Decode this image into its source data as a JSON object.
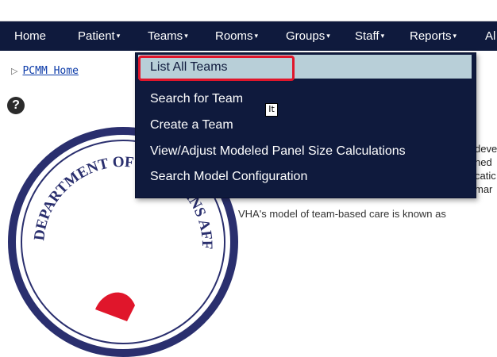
{
  "navbar": {
    "items": [
      {
        "label": "Home",
        "has_caret": false
      },
      {
        "label": "Patient",
        "has_caret": true
      },
      {
        "label": "Teams",
        "has_caret": true
      },
      {
        "label": "Rooms",
        "has_caret": true
      },
      {
        "label": "Groups",
        "has_caret": true
      },
      {
        "label": "Staff",
        "has_caret": true
      },
      {
        "label": "Reports",
        "has_caret": true
      },
      {
        "label": "Al",
        "has_caret": false
      }
    ],
    "caret_glyph": "▾",
    "background": "#0f1a3d"
  },
  "breadcrumb": {
    "label": "PCMM Home"
  },
  "teams_menu": {
    "items": [
      "List All Teams",
      "Search for Team",
      "Create a Team",
      "View/Adjust Modeled Panel Size Calculations",
      "Search Model Configuration"
    ],
    "highlighted_index": 0,
    "highlight_color": "#b8cfd8",
    "annotation_border_color": "#e0162b"
  },
  "seal": {
    "text": "DEPARTMENT OF VETERANS AFFAIRS"
  },
  "cursor_tooltip": "It",
  "body_text": {
    "line1": "deve",
    "line2": "ned",
    "line3": "catic",
    "line4": "mar",
    "bottom": "VHA's model of team-based care is known as"
  },
  "icons": {
    "help": "question-mark-icon",
    "breadcrumb_arrow": "triangle-right-icon"
  }
}
